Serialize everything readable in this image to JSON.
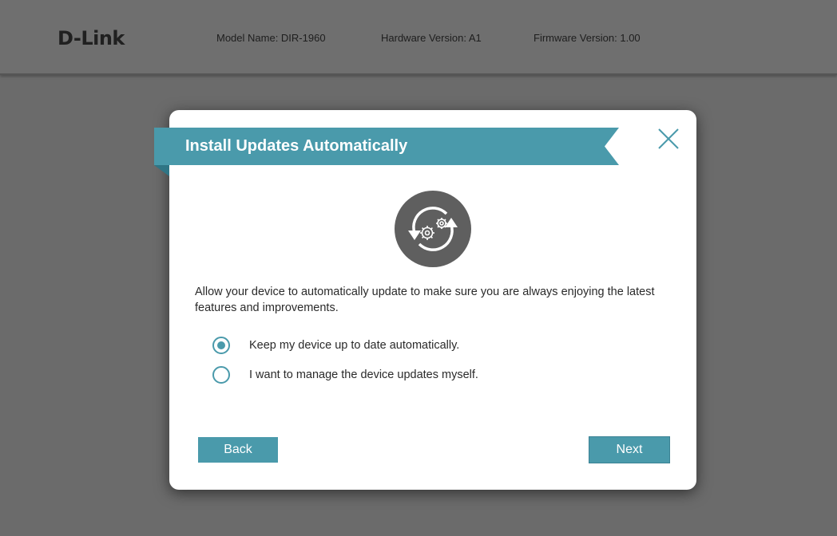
{
  "header": {
    "logo": "D-Link",
    "model_name": "Model Name: DIR-1960",
    "hardware_version": "Hardware Version: A1",
    "firmware_version": "Firmware Version: 1.00"
  },
  "dialog": {
    "title": "Install Updates Automatically",
    "description": "Allow your device to automatically update to make sure you are always enjoying the latest features and improvements.",
    "options": [
      {
        "label": "Keep my device up to date automatically.",
        "selected": true
      },
      {
        "label": "I want to manage the device updates myself.",
        "selected": false
      }
    ],
    "back_label": "Back",
    "next_label": "Next"
  },
  "icons": {
    "close": "close-icon",
    "update": "update-gears-icon"
  },
  "colors": {
    "accent": "#4a9aab",
    "accent_dark": "#2f7585",
    "overlay": "#6b6b6b",
    "icon_gray": "#5f5f5f"
  }
}
